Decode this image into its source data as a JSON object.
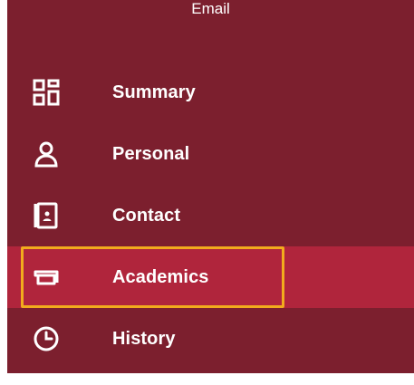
{
  "header": {
    "email_label": "Email"
  },
  "nav": {
    "items": [
      {
        "label": "Summary",
        "icon": "dashboard-icon"
      },
      {
        "label": "Personal",
        "icon": "person-icon"
      },
      {
        "label": "Contact",
        "icon": "contact-book-icon"
      },
      {
        "label": "Academics",
        "icon": "graduation-cap-icon",
        "active": true
      },
      {
        "label": "History",
        "icon": "clock-icon"
      }
    ]
  },
  "colors": {
    "panel_bg": "#7c1f2e",
    "active_bg": "#b0253c",
    "focus_outline": "#f2ab1d",
    "text": "#ffffff"
  }
}
